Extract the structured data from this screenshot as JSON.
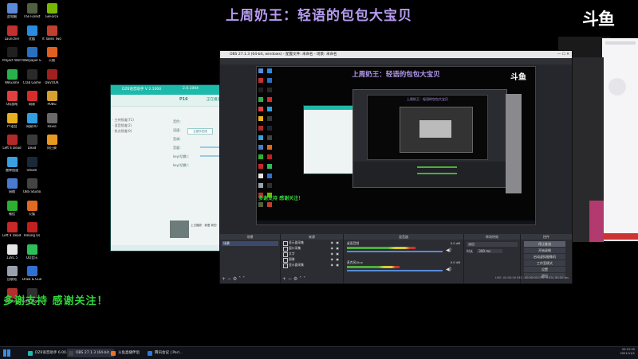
{
  "overlay": {
    "title": "上周奶王：轻语的包包大宝贝",
    "logo": "斗鱼",
    "thanks": "多谢支持 感谢关注！"
  },
  "desktop_icons": [
    {
      "label": "此电脑",
      "color": "#5a8ad8"
    },
    {
      "label": "Launcher",
      "color": "#c23030"
    },
    {
      "label": "Project Winter",
      "color": "#202020"
    },
    {
      "label": "WeGame",
      "color": "#2ab24a"
    },
    {
      "label": "QQ游戏",
      "color": "#e04040"
    },
    {
      "label": "YY语音",
      "color": "#e8b020"
    },
    {
      "label": "Left 4 Dead",
      "color": "#b02a2a"
    },
    {
      "label": "雷神加速",
      "color": "#3aa0e0"
    },
    {
      "label": "网络",
      "color": "#4a7ad0"
    },
    {
      "label": "微信",
      "color": "#2db030"
    },
    {
      "label": "Left 4 Dead 2",
      "color": "#c82828"
    },
    {
      "label": "1281.5",
      "color": "#e6e6e6"
    },
    {
      "label": "回收站",
      "color": "#9aa2ae"
    },
    {
      "label": "Welcome",
      "color": "#b03030"
    },
    {
      "label": "The Forest",
      "color": "#506040"
    },
    {
      "label": "优酷",
      "color": "#2a8ce0"
    },
    {
      "label": "Wallpaper Engine",
      "color": "#2a70c0"
    },
    {
      "label": "Crab Game",
      "color": "#2a2a2a"
    },
    {
      "label": "网易",
      "color": "#d82c2c"
    },
    {
      "label": "网易UU",
      "color": "#30a0e0"
    },
    {
      "label": "Dead",
      "color": "#3a3a3a"
    },
    {
      "label": "Steam",
      "color": "#1b2838"
    },
    {
      "label": "OBS Studio",
      "color": "#444"
    },
    {
      "label": "火狐",
      "color": "#e06a20"
    },
    {
      "label": "Among Us",
      "color": "#c02020"
    },
    {
      "label": "QQ音乐",
      "color": "#2fbf5a"
    },
    {
      "label": "Draw & Guess",
      "color": "#3070d0"
    },
    {
      "label": "Little Nightmares",
      "color": "#303030"
    },
    {
      "label": "GeForce",
      "color": "#76b900"
    },
    {
      "label": "It Takes Two",
      "color": "#c04030"
    },
    {
      "label": "火绒",
      "color": "#e06020"
    },
    {
      "label": "DEVOUR",
      "color": "#a02020"
    },
    {
      "label": "PUBG",
      "color": "#d8a030"
    },
    {
      "label": "Ravio",
      "color": "#6a6a6a"
    },
    {
      "label": "向日葵",
      "color": "#e89a20"
    }
  ],
  "teal_window": {
    "title": "DZ6语音助手 V 2.1000",
    "version": "2.0.1004",
    "sidebar": [
      "· 主持频道(71)",
      "· 语音频道(2)",
      "· 热点频道(0)"
    ],
    "tab": "P16",
    "tab2": "正在播放",
    "form": [
      "音色：",
      "语速：",
      "音调：",
      "音量：",
      "key(切换)：",
      "key(切换)："
    ],
    "chip": "云音乐在线",
    "footer": "上日播放 · 我爱 我的"
  },
  "obs": {
    "window_title": "OBS 27.1.3 (64-bit, windows) - 配置文件: 未命名 - 场景: 未命名",
    "inner_title": "上周奶王：轻语的包包大宝贝",
    "inner_thanks": "多谢支持 感谢关注！",
    "docks": {
      "scenes": "场景",
      "sources": "来源",
      "mixer": "混音器",
      "transitions": "转场特效",
      "controls": "控件"
    },
    "scene_items": [
      "场景"
    ],
    "source_items": [
      "显示器采集",
      "窗口采集",
      "文字",
      "图像",
      "显示器采集"
    ],
    "mixer_items": [
      {
        "name": "桌面音频",
        "db": "0.0 dB",
        "level": 0.72
      },
      {
        "name": "麦克风/Aux",
        "db": "0.0 dB",
        "level": 0.55
      }
    ],
    "transition": {
      "type_label": "淡出",
      "duration_label": "时长",
      "duration": "300 ms"
    },
    "controls": [
      "停止推流",
      "开始录制",
      "启动虚拟摄像机",
      "工作室模式",
      "设置",
      "退出"
    ],
    "status": "LIVE: 00:00:00   REC: 00:00:00   CPU: 9.3%, 60.00 fps"
  },
  "taskbar": {
    "items": [
      {
        "label": "DZ6语音助手 6.00...",
        "color": "#1db9aa"
      },
      {
        "label": "OBS 27.1.3 (64-bit...",
        "color": "#444"
      },
      {
        "label": "斗鱼直播伴侣",
        "color": "#f07020"
      },
      {
        "label": "腾讯会议 | Parl...",
        "color": "#2a7ae0"
      }
    ],
    "time": "20:15:35",
    "date": "2021/11/1"
  },
  "colors": {
    "title_purple": "#b59bf0",
    "thanks_green": "#2fd53a",
    "obs_bg": "#25272c"
  }
}
